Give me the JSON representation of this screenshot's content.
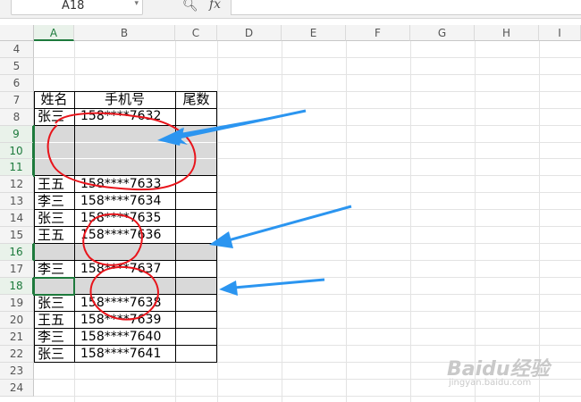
{
  "formula_bar": {
    "cell_ref": "A18",
    "fx_label": "fx",
    "formula": ""
  },
  "columns": [
    "A",
    "B",
    "C",
    "D",
    "E",
    "F",
    "G",
    "H",
    "I"
  ],
  "rows": [
    "4",
    "5",
    "6",
    "7",
    "8",
    "9",
    "10",
    "11",
    "12",
    "13",
    "14",
    "15",
    "16",
    "17",
    "18",
    "19",
    "20",
    "21",
    "22",
    "23",
    "24"
  ],
  "table": {
    "headers": [
      "姓名",
      "手机号",
      "尾数"
    ],
    "rows": [
      {
        "row": "8",
        "name": "张三",
        "phone": "158****7632"
      },
      {
        "row": "12",
        "name": "王五",
        "phone": "158****7633"
      },
      {
        "row": "13",
        "name": "李三",
        "phone": "158****7634"
      },
      {
        "row": "14",
        "name": "张三",
        "phone": "158****7635"
      },
      {
        "row": "15",
        "name": "王五",
        "phone": "158****7636"
      },
      {
        "row": "17",
        "name": "李三",
        "phone": "158****7637"
      },
      {
        "row": "19",
        "name": "张三",
        "phone": "158****7638"
      },
      {
        "row": "20",
        "name": "王五",
        "phone": "158****7639"
      },
      {
        "row": "21",
        "name": "李三",
        "phone": "158****7640"
      },
      {
        "row": "22",
        "name": "张三",
        "phone": "158****7641"
      }
    ]
  },
  "selected_cell": "A18",
  "colors": {
    "accent": "#1d7a3c",
    "highlight_row": "#d9d9d9",
    "arrow": "#2b95f0",
    "circle": "#e8141b"
  },
  "watermark": {
    "brand": "Baidu经验",
    "url": "jingyan.baidu.com"
  }
}
